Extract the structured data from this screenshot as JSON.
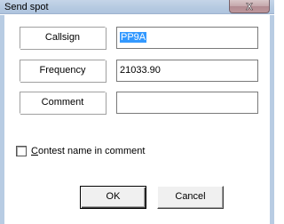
{
  "window": {
    "title": "Send spot",
    "close_glyph": "X",
    "close_icon": "close-icon"
  },
  "fields": {
    "callsign": {
      "label": "Callsign",
      "value": "PP9A",
      "selected": true
    },
    "frequency": {
      "label": "Frequency",
      "value": "21033.90"
    },
    "comment": {
      "label": "Comment",
      "value": ""
    }
  },
  "checkbox": {
    "label_accel": "C",
    "label_rest": "ontest name in comment",
    "checked": false
  },
  "buttons": {
    "ok_label": "OK",
    "cancel_label": "Cancel"
  },
  "colors": {
    "titlebar": "#b6cae1",
    "close_button": "#c4a7ab",
    "selection": "#3399ff"
  }
}
